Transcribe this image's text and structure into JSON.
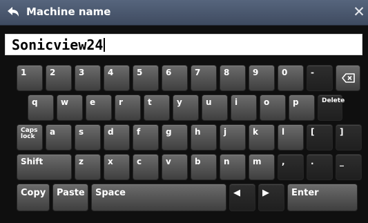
{
  "window": {
    "title": "Machine name"
  },
  "input": {
    "value": "Sonicview24"
  },
  "keys": {
    "row1": [
      "1",
      "2",
      "3",
      "4",
      "5",
      "6",
      "7",
      "8",
      "9",
      "0",
      "-"
    ],
    "row2": [
      "q",
      "w",
      "e",
      "r",
      "t",
      "y",
      "u",
      "i",
      "o",
      "p"
    ],
    "delete": "Delete",
    "row3": [
      "a",
      "s",
      "d",
      "f",
      "g",
      "h",
      "j",
      "k",
      "l",
      "[",
      "]"
    ],
    "caps": "Caps\nlock",
    "shift": "Shift",
    "row4": [
      "z",
      "x",
      "c",
      "v",
      "b",
      "n",
      "m",
      ",",
      ".",
      "_"
    ],
    "copy": "Copy",
    "paste": "Paste",
    "space": "Space",
    "left_arrow": "◀",
    "right_arrow": "▶",
    "enter": "Enter"
  }
}
